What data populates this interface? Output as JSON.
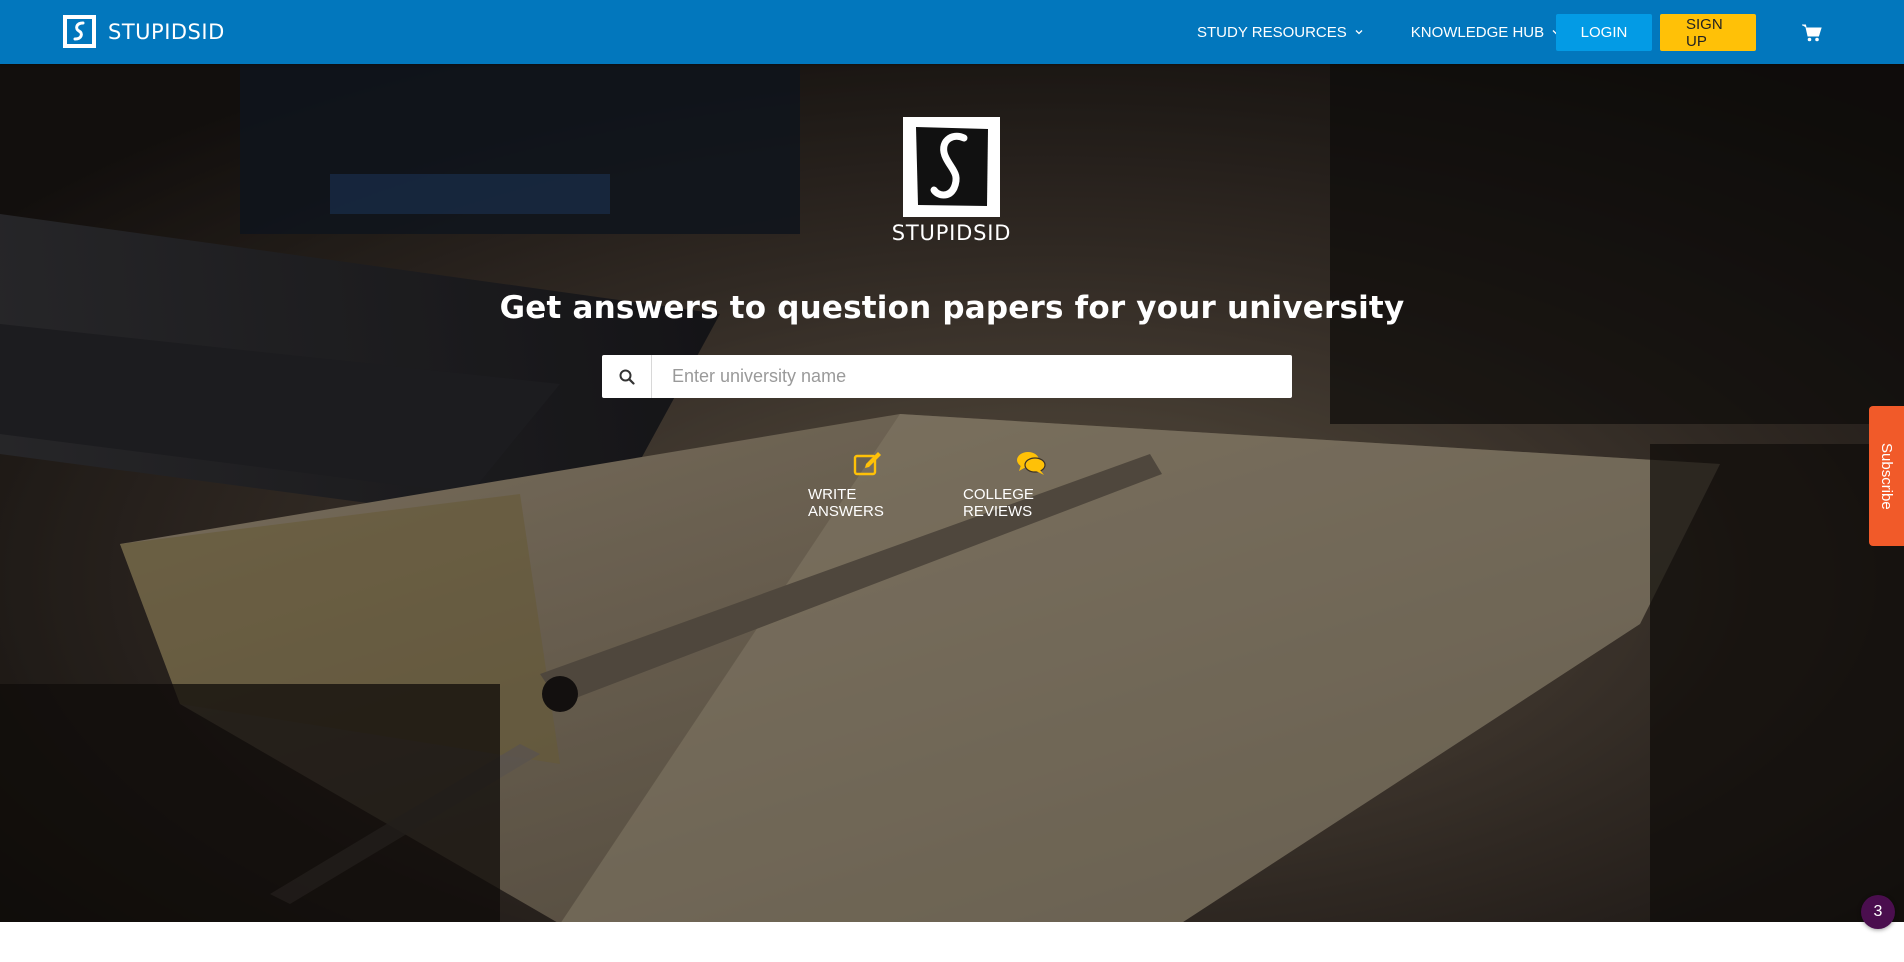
{
  "header": {
    "brand_name": "STUPIDSID",
    "nav": {
      "study_resources": "STUDY RESOURCES",
      "knowledge_hub": "KNOWLEDGE HUB"
    },
    "login_label": "LOGIN",
    "signup_label": "SIGN UP",
    "cart_icon": "cart-icon"
  },
  "hero": {
    "logo_name": "STUPIDSID",
    "headline": "Get answers to question papers for your university",
    "search": {
      "placeholder": "Enter university name",
      "value": ""
    },
    "links": [
      {
        "label": "WRITE ANSWERS",
        "icon": "edit-icon"
      },
      {
        "label": "COLLEGE REVIEWS",
        "icon": "comments-icon"
      }
    ]
  },
  "subscribe_label": "Subscribe",
  "notification_count": "3",
  "colors": {
    "nav_bg": "#0277bd",
    "login_bg": "#039be5",
    "signup_bg": "#ffc107",
    "accent_icon": "#ffc107",
    "subscribe_bg": "#f15a29",
    "badge_bg": "#4a0e4e"
  }
}
